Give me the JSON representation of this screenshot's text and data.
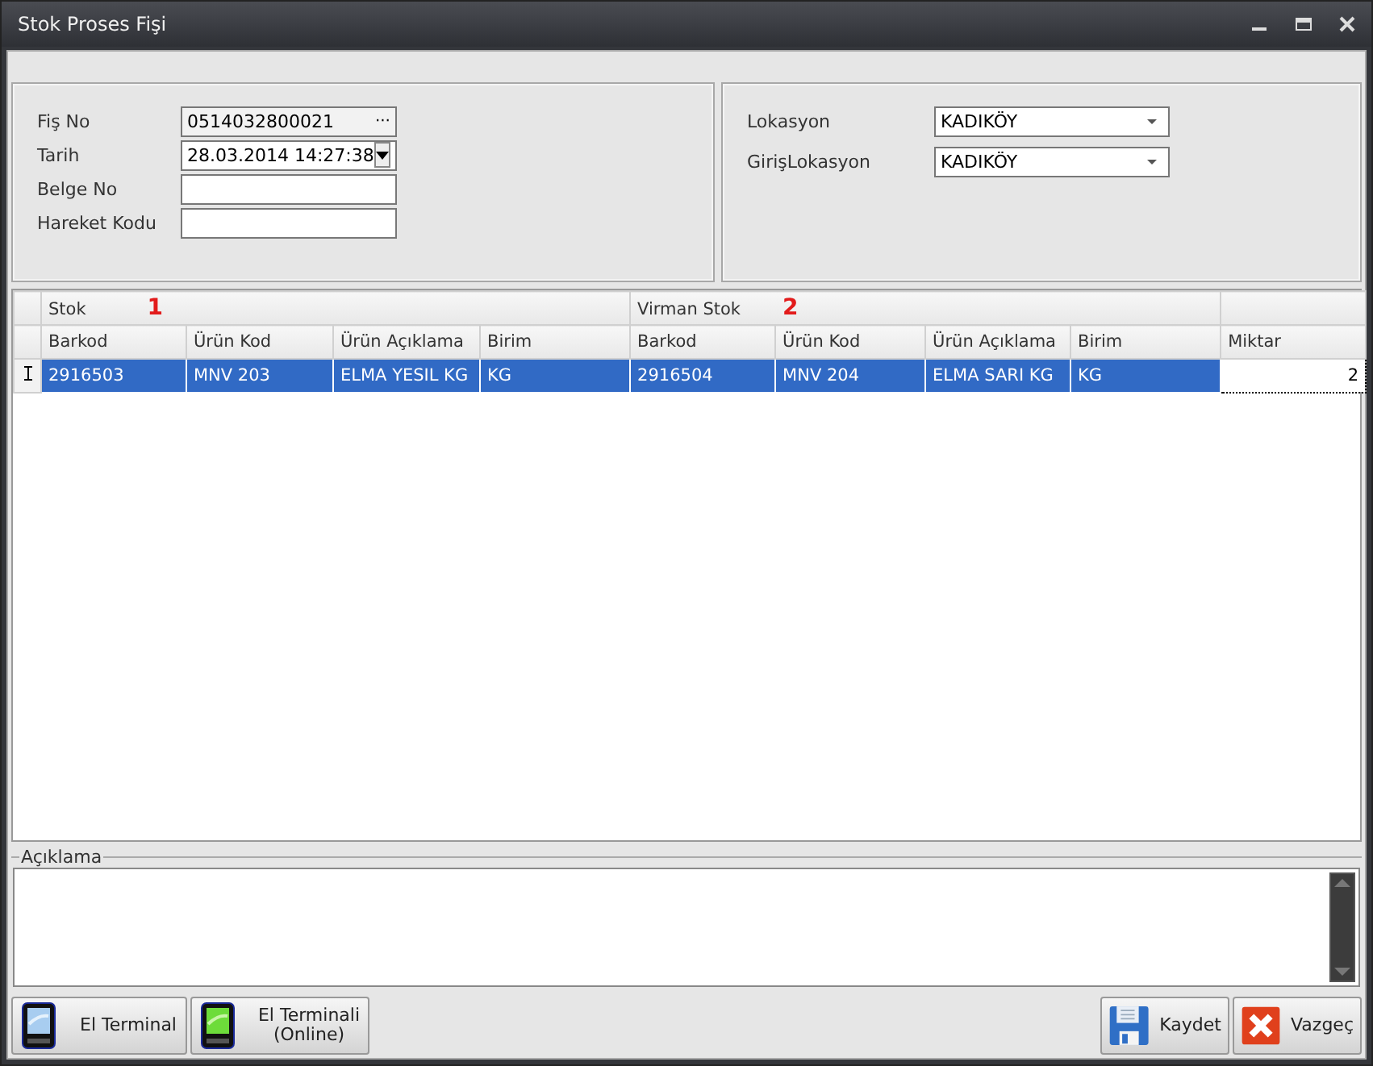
{
  "window": {
    "title": "Stok Proses Fişi"
  },
  "header_left": [
    {
      "label": "Fiş No",
      "kind": "lookup",
      "value": "0514032800021",
      "button": "···"
    },
    {
      "label": "Tarih",
      "kind": "date",
      "value": "28.03.2014 14:27:38"
    },
    {
      "label": "Belge No",
      "kind": "text"
    },
    {
      "label": "Hareket Kodu",
      "kind": "text"
    }
  ],
  "header_right": [
    {
      "label": "Lokasyon",
      "kind": "combo",
      "value": "KADIKÖY"
    },
    {
      "label": "GirişLokasyon",
      "kind": "combo",
      "value": "KADIKÖY"
    }
  ],
  "table": {
    "bands": [
      {
        "title": "Stok",
        "marker": "1"
      },
      {
        "title": "Virman Stok",
        "marker": "2"
      }
    ],
    "columns": [
      "Barkod",
      "Ürün Kod",
      "Ürün Açıklama",
      "Birim",
      "Barkod",
      "Ürün Kod",
      "Ürün Açıklama",
      "Birim",
      "Miktar"
    ],
    "rows": [
      {
        "selected": true,
        "editing": true,
        "cells": [
          "2916503",
          "MNV 203",
          "ELMA YESIL  KG",
          "KG",
          "2916504",
          "MNV 204",
          "ELMA SARI  KG",
          "KG",
          "2"
        ]
      }
    ]
  },
  "notes": {
    "label": "Açıklama"
  },
  "buttons_left": [
    {
      "label": "El Terminal",
      "kind": "terminal"
    },
    {
      "label": "El Terminali\n(Online)",
      "kind": "terminal-online"
    }
  ],
  "buttons_right": [
    {
      "label": "Kaydet",
      "kind": "save"
    },
    {
      "label": "Vazgeç",
      "kind": "cancel"
    }
  ]
}
